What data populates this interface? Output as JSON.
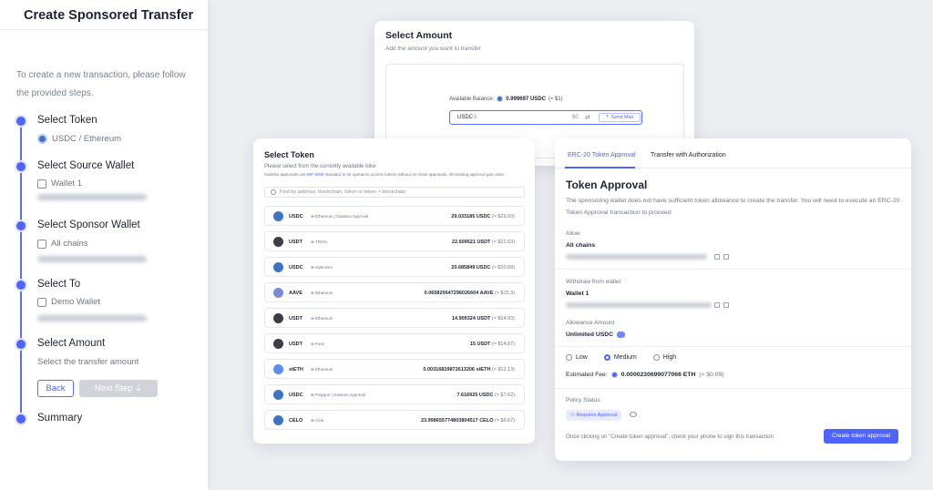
{
  "wizard": {
    "title": "Create Sponsored Transfer",
    "intro": "To create a new transaction, please follow the provided steps.",
    "steps": [
      {
        "title": "Select Token",
        "sub": "USDC / Ethereum"
      },
      {
        "title": "Select Source Wallet",
        "sub": "Wallet 1"
      },
      {
        "title": "Select Sponsor Wallet",
        "sub": "All chains"
      },
      {
        "title": "Select To",
        "sub": "Demo Wallet"
      },
      {
        "title": "Select Amount",
        "sub": "Select the transfer amount"
      },
      {
        "title": "Summary",
        "sub": ""
      }
    ],
    "back_label": "Back",
    "next_label": "Next Step ⇣"
  },
  "amount": {
    "title": "Select Amount",
    "subtitle": "Add the amount you want to transfer",
    "balance_label": "Available Balance:",
    "balance_value": "0.999697 USDC",
    "balance_usd": "(≈ $1)",
    "currency": "USDC",
    "input_value": "0",
    "usd_value": "$0",
    "send_max_label": "⇡ Send Max"
  },
  "tokens": {
    "title": "Select Token",
    "subtitle": "Please select from the currently available toke",
    "gasless_note_prefix": "Gasless approvals use",
    "gasless_note_link": "EIP-3009",
    "gasless_note_suffix": "standard to let operators access tokens without on-chain approvals, eliminating approval gas costs",
    "search_placeholder": "Find by address, blockchain, token or token + blockchain",
    "rows": [
      {
        "symbol": "USDC",
        "chain": "⊕ Ethereum  |  Gasless Approval",
        "amount": "29.033185 USDC",
        "usd": "(≈ $29.03)",
        "color": "#3e73c4"
      },
      {
        "symbol": "USDT",
        "chain": "⊕ TRON",
        "amount": "22.609521 USDT",
        "usd": "(≈ $22.63)",
        "color": "#3b3e48"
      },
      {
        "symbol": "USDC",
        "chain": "⊕ Optimism",
        "amount": "20.685849 USDC",
        "usd": "(≈ $20.68)",
        "color": "#3e73c4"
      },
      {
        "symbol": "AAVE",
        "chain": "⊕ Ethereum",
        "amount": "0.065820647296026604 AAVE",
        "usd": "(≈ $15.3)",
        "color": "#7a8bd6"
      },
      {
        "symbol": "USDT",
        "chain": "⊕ Ethereum",
        "amount": "14.909324 USDT",
        "usd": "(≈ $14.93)",
        "color": "#3b3e48"
      },
      {
        "symbol": "USDT",
        "chain": "⊕ Fuse",
        "amount": "15 USDT",
        "usd": "(≈ $14.87)",
        "color": "#3b3e48"
      },
      {
        "symbol": "stETH",
        "chain": "⊕ Ethereum",
        "amount": "0.00316829872613206 stETH",
        "usd": "(≈ $12.13)",
        "color": "#5c8cf0"
      },
      {
        "symbol": "USDC",
        "chain": "⊕ Polygon  |  Gasless Approval",
        "amount": "7.616925 USDC",
        "usd": "(≈ $7.62)",
        "color": "#3e73c4"
      },
      {
        "symbol": "CELO",
        "chain": "⊕ Celo",
        "amount": "23.998655774803804517 CELO",
        "usd": "(≈ $6.67)",
        "color": "#3e73c4"
      }
    ]
  },
  "approval": {
    "tab_active": "ERC-20 Token Approval",
    "tab_other": "Transfer with Authorization",
    "title": "Token Approval",
    "description": "The sponsoring wallet does not have sufficient token allowance to create the transfer. You will need to execute an ERC-20 Token Approval transaction to proceed",
    "allow_label": "Allow",
    "allow_value": "All chains",
    "withdraw_label": "Withdraw from wallet",
    "withdraw_value": "Wallet 1",
    "allowance_label": "Allowance Amount",
    "allowance_value": "Unlimited USDC",
    "fee_options": [
      "Low",
      "Medium",
      "High"
    ],
    "fee_selected": "Medium",
    "fee_label": "Estimated Fee:",
    "fee_value": "0.0000230699077066 ETH",
    "fee_usd": "(≈ $0.09)",
    "policy_label": "Policy Status",
    "policy_badge": "⚇ Requires Approval",
    "note": "Once clicking on \"Create token approval\", check your phone to sign this transaction",
    "create_label": "Create token approval"
  }
}
